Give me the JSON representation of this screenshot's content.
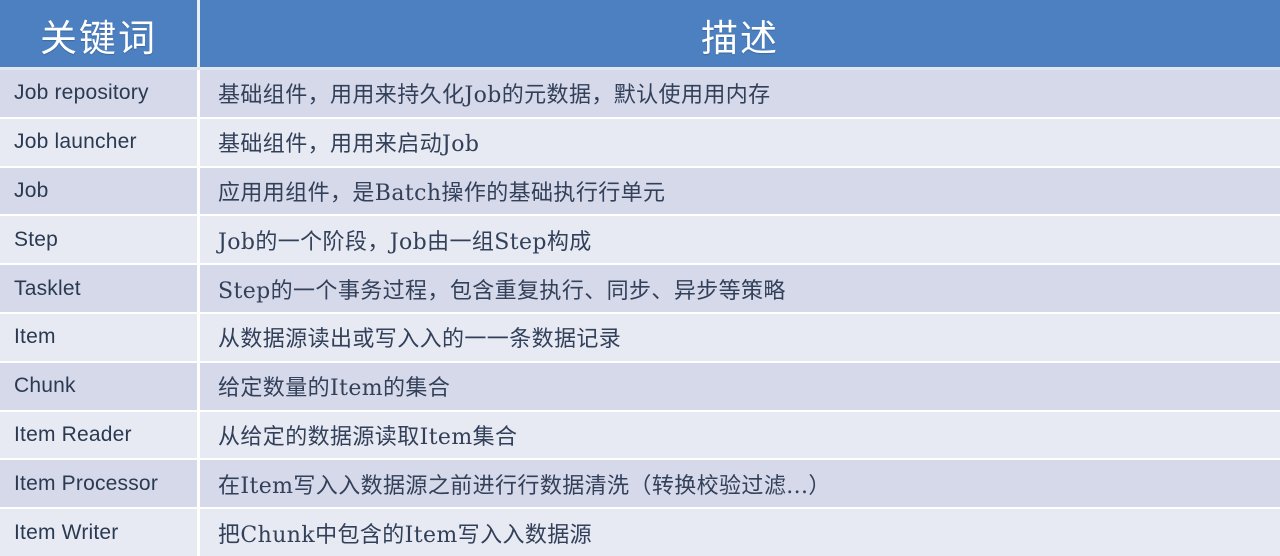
{
  "table": {
    "columns": {
      "keyword_header": "关键词",
      "description_header": "描述"
    },
    "colors": {
      "header_background": "#4d80c0",
      "header_text": "#ffffff",
      "row_odd_background": "#d6d9e9",
      "row_even_background": "#e7eaf2",
      "row_separator": "#ffffff",
      "body_text": "#2c3b54"
    },
    "rows": [
      {
        "keyword": "Job repository",
        "description": "基础组件，用用来持久化Job的元数据，默认使用用内存"
      },
      {
        "keyword": "Job launcher",
        "description": "基础组件，用用来启动Job"
      },
      {
        "keyword": "Job",
        "description": "应用用组件，是Batch操作的基础执行行单元"
      },
      {
        "keyword": "Step",
        "description": "Job的一个阶段，Job由一组Step构成"
      },
      {
        "keyword": "Tasklet",
        "description": "Step的一个事务过程，包含重复执行、同步、异步等策略"
      },
      {
        "keyword": "Item",
        "description": "从数据源读出或写入入的一一条数据记录"
      },
      {
        "keyword": "Chunk",
        "description": "给定数量的Item的集合"
      },
      {
        "keyword": "Item Reader",
        "description": "从给定的数据源读取Item集合"
      },
      {
        "keyword": "Item Processor",
        "description": "在Item写入入数据源之前进行行数据清洗（转换校验过滤...）"
      },
      {
        "keyword": "Item Writer",
        "description": "把Chunk中包含的Item写入入数据源"
      }
    ]
  }
}
